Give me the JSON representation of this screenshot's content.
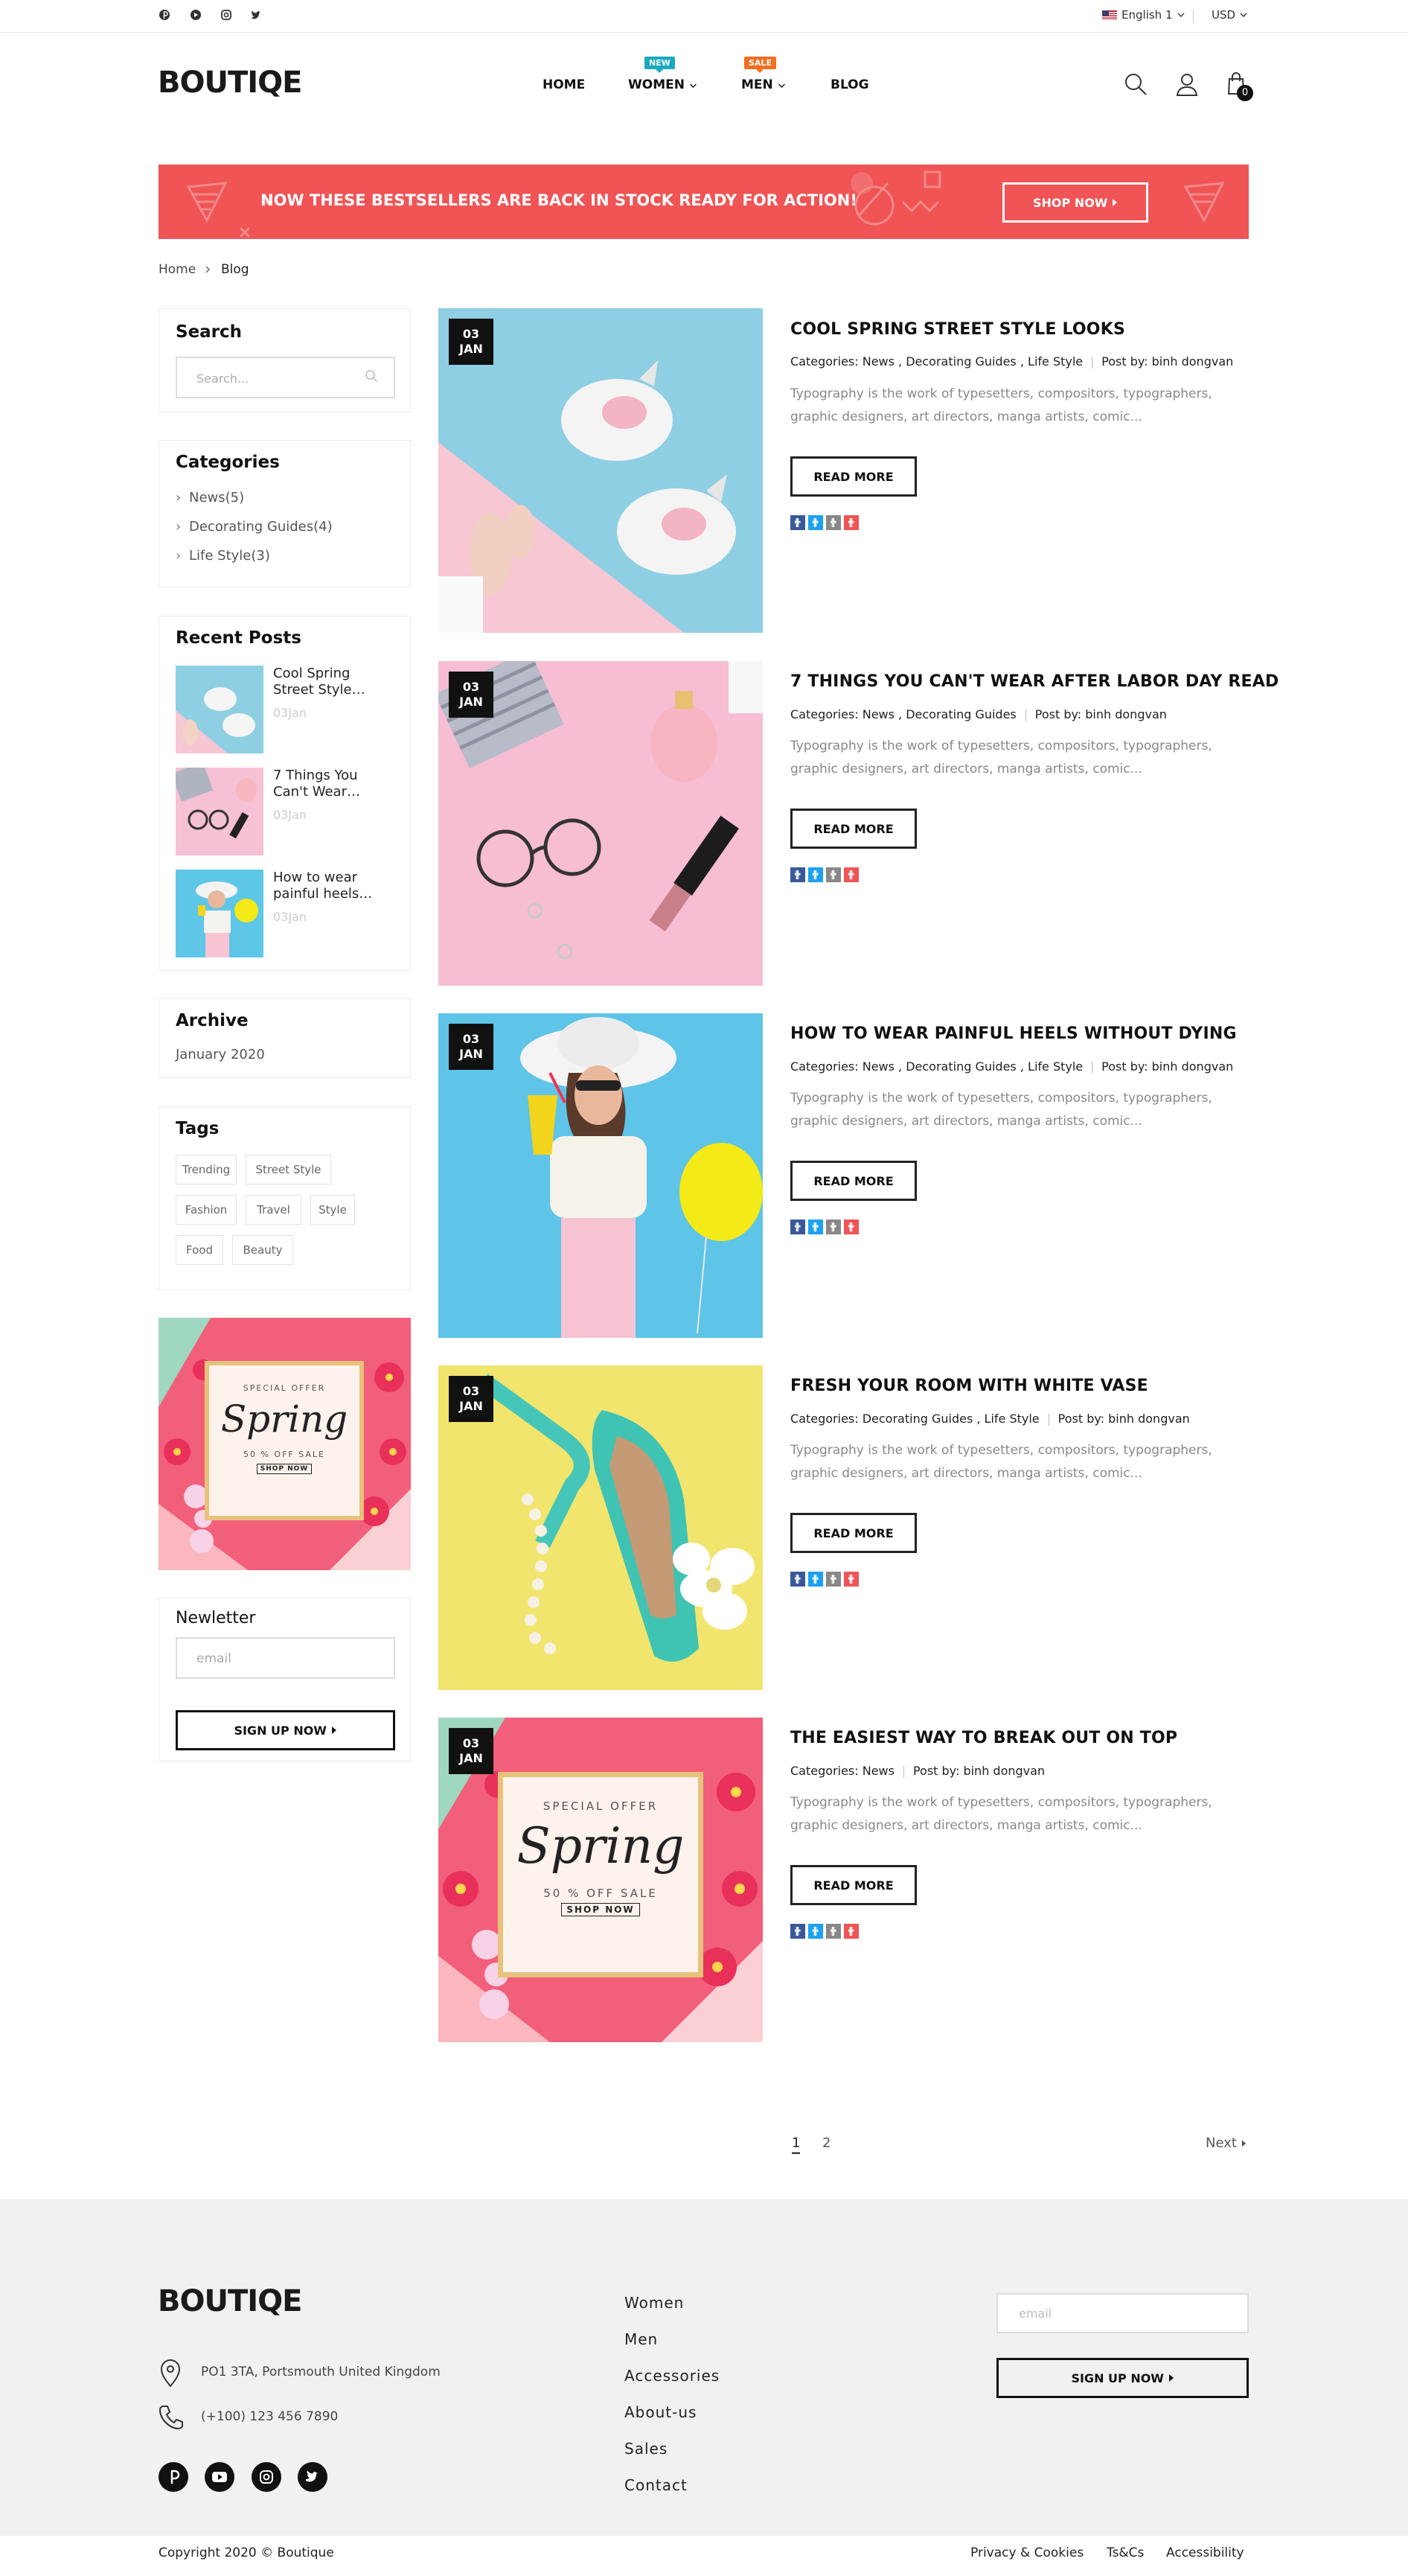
{
  "topbar": {
    "social_icons": [
      "pinterest-icon",
      "youtube-icon",
      "instagram-icon",
      "twitter-icon"
    ],
    "language": "English",
    "language_suffix": "1",
    "currency": "USD"
  },
  "header": {
    "logo": "BOUTIQE",
    "nav": [
      {
        "label": "HOME",
        "badge": "",
        "has_dropdown": false
      },
      {
        "label": "WOMEN",
        "badge": "NEW",
        "badge_color": "#1aa9bf",
        "has_dropdown": true
      },
      {
        "label": "MEN",
        "badge": "SALE",
        "badge_color": "#f07022",
        "has_dropdown": true
      },
      {
        "label": "BLOG",
        "badge": "",
        "has_dropdown": false
      }
    ],
    "cart_count": "0"
  },
  "banner": {
    "text": "NOW THESE BESTSELLERS ARE BACK IN STOCK READY FOR ACTION!",
    "button": "SHOP NOW",
    "color": "#f05455"
  },
  "breadcrumb": {
    "home": "Home",
    "current": "Blog"
  },
  "sidebar": {
    "search": {
      "title": "Search",
      "placeholder": "Search..."
    },
    "categories": {
      "title": "Categories",
      "items": [
        "News(5)",
        "Decorating Guides(4)",
        "Life Style(3)"
      ]
    },
    "recent_posts": {
      "title": "Recent Posts",
      "items": [
        {
          "title": "Cool Spring Street Style…",
          "date": "03Jan"
        },
        {
          "title": "7 Things You Can't Wear…",
          "date": "03Jan"
        },
        {
          "title": "How to wear painful heels…",
          "date": "03Jan"
        }
      ]
    },
    "archive": {
      "title": "Archive",
      "items": [
        "January 2020"
      ]
    },
    "tags": {
      "title": "Tags",
      "items": [
        "Trending",
        "Street Style",
        "Fashion",
        "Travel",
        "Style",
        "Food",
        "Beauty"
      ]
    },
    "promo": {
      "line1": "SPECIAL OFFER",
      "line2": "Spring",
      "line3": "50 % OFF SALE",
      "line4": "SHOP NOW"
    },
    "newsletter": {
      "title": "Newletter",
      "placeholder": "email",
      "button": "SIGN UP NOW"
    }
  },
  "posts": [
    {
      "day": "03",
      "month": "JAN",
      "title": "COOL SPRING STREET STYLE LOOKS",
      "categories": "Categories: News , Decorating Guides , Life Style",
      "author": "Post by: binh dongvan",
      "excerpt": "Typography is the work of typesetters, compositors, typographers, graphic designers, art directors, manga artists, comic...",
      "button": "READ MORE"
    },
    {
      "day": "03",
      "month": "JAN",
      "title": "7 THINGS YOU CAN'T WEAR AFTER LABOR DAY READ",
      "categories": "Categories: News , Decorating Guides",
      "author": "Post by: binh dongvan",
      "excerpt": "Typography is the work of typesetters, compositors, typographers, graphic designers, art directors, manga artists, comic...",
      "button": "READ MORE"
    },
    {
      "day": "03",
      "month": "JAN",
      "title": "HOW TO WEAR PAINFUL HEELS WITHOUT DYING",
      "categories": "Categories: News , Decorating Guides , Life Style",
      "author": "Post by: binh dongvan",
      "excerpt": "Typography is the work of typesetters, compositors, typographers, graphic designers, art directors, manga artists, comic...",
      "button": "READ MORE"
    },
    {
      "day": "03",
      "month": "JAN",
      "title": "FRESH YOUR ROOM WITH WHITE VASE",
      "categories": "Categories: Decorating Guides , Life Style",
      "author": "Post by: binh dongvan",
      "excerpt": "Typography is the work of typesetters, compositors, typographers, graphic designers, art directors, manga artists, comic...",
      "button": "READ MORE"
    },
    {
      "day": "03",
      "month": "JAN",
      "title": "THE EASIEST WAY TO BREAK OUT ON TOP",
      "categories": "Categories: News",
      "author": "Post by: binh dongvan",
      "excerpt": "Typography is the work of typesetters, compositors, typographers, graphic designers, art directors, manga artists, comic...",
      "button": "READ MORE"
    }
  ],
  "share_colors": [
    "#3b5998",
    "#1da1f2",
    "#888888",
    "#f05455"
  ],
  "pagination": {
    "pages": [
      "1",
      "2"
    ],
    "current": "1",
    "next": "Next"
  },
  "footer": {
    "logo": "BOUTIQE",
    "address": "PO1 3TA, Portsmouth United Kingdom",
    "phone": "(+100) 123 456 7890",
    "links": [
      "Women",
      "Men",
      "Accessories",
      "About-us",
      "Sales",
      "Contact"
    ],
    "email_placeholder": "email",
    "button": "SIGN UP NOW",
    "social_icons": [
      "pinterest-icon",
      "youtube-icon",
      "instagram-icon",
      "twitter-icon"
    ],
    "copyright": "Copyright 2020 © Boutique",
    "bottom_links": [
      "Privacy & Cookies",
      "Ts&Cs",
      "Accessibility"
    ]
  }
}
